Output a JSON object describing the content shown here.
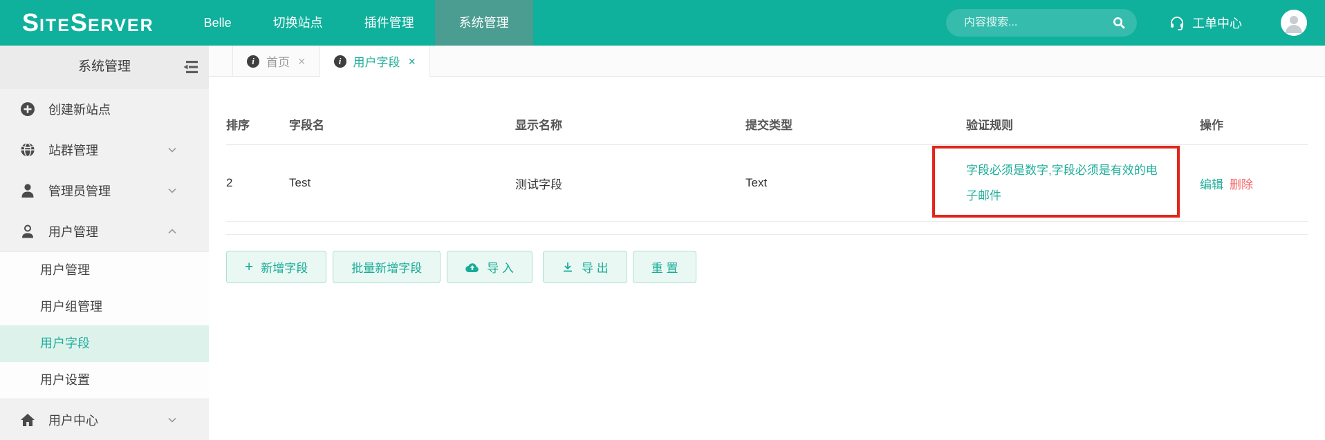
{
  "ui": {
    "close_glyph": "×",
    "plus_glyph": "+"
  },
  "header": {
    "logo_s1": "S",
    "logo_p1": "ITE",
    "logo_s2": "S",
    "logo_p2": "ERVER",
    "nav": [
      {
        "label": "Belle",
        "active": false
      },
      {
        "label": "切换站点",
        "active": false
      },
      {
        "label": "插件管理",
        "active": false
      },
      {
        "label": "系统管理",
        "active": true
      }
    ],
    "search": {
      "placeholder": "内容搜索..."
    },
    "ticket_center_label": "工单中心"
  },
  "sidebar": {
    "title": "系统管理",
    "items": [
      {
        "label": "创建新站点",
        "icon": "plus-circle-icon"
      },
      {
        "label": "站群管理",
        "icon": "globe-icon",
        "chevron": "down"
      },
      {
        "label": "管理员管理",
        "icon": "admin-icon",
        "chevron": "down"
      },
      {
        "label": "用户管理",
        "icon": "user-icon",
        "chevron": "up",
        "expanded": true,
        "children": [
          {
            "label": "用户管理",
            "active": false
          },
          {
            "label": "用户组管理",
            "active": false
          },
          {
            "label": "用户字段",
            "active": true
          },
          {
            "label": "用户设置",
            "active": false
          }
        ]
      },
      {
        "label": "用户中心",
        "icon": "home-icon",
        "chevron": "down"
      }
    ]
  },
  "tabs": [
    {
      "label": "首页",
      "active": false
    },
    {
      "label": "用户字段",
      "active": true
    }
  ],
  "table": {
    "columns": [
      "排序",
      "字段名",
      "显示名称",
      "提交类型",
      "验证规则",
      "操作"
    ],
    "row": {
      "order": "2",
      "field_name": "Test",
      "display_name": "测试字段",
      "submit_type": "Text",
      "validation_rules": "字段必须是数字,字段必须是有效的电子邮件",
      "action_edit": "编辑",
      "action_delete": "删除"
    }
  },
  "toolbar": {
    "buttons": [
      "新增字段",
      "批量新增字段",
      "导 入",
      "导 出",
      "重 置"
    ]
  },
  "colors": {
    "accent": "#0fb09c",
    "nav_active_bg": "#4a9d90",
    "active_text": "#1fae9a",
    "danger": "#f56c6c",
    "annotation": "#e2251b"
  }
}
